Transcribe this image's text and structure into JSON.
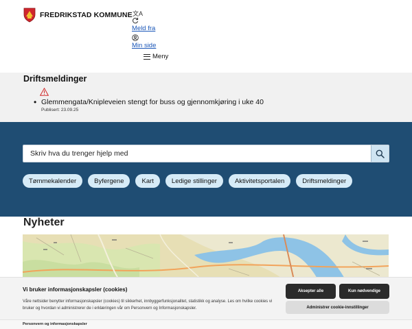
{
  "header": {
    "brand": "FREDRIKSTAD KOMMUNE",
    "links": [
      {
        "label": "Meld fra",
        "icon": "refresh-icon"
      },
      {
        "label": "Min side",
        "icon": "user-icon"
      }
    ],
    "menu_label": "Meny"
  },
  "alerts": {
    "title": "Driftsmeldinger",
    "items": [
      {
        "text": "Glemmengata/Knipleveien stengt for buss og gjennomkjøring i uke 40",
        "published": "Publisert: 23.09.25"
      }
    ]
  },
  "search": {
    "placeholder": "Skriv hva du trenger hjelp med"
  },
  "quick_links": [
    "Tømmekalender",
    "Byfergene",
    "Kart",
    "Ledige stillinger",
    "Aktivitetsportalen",
    "Driftsmeldinger"
  ],
  "news": {
    "title": "Nyheter"
  },
  "cookie": {
    "title": "Vi bruker informasjonskapsler (cookies)",
    "text": "Våre nettsider benytter informasjonskapsler (cookies) til sikkerhet, innbyggerfunksjonalitet, statistikk og analyse. Les om hvilke cookies vi bruker og hvordan vi administrerer de i erklæringen vår om Personvern og Informasjonskapsler.",
    "accept_label": "Aksepter alle",
    "necessary_label": "Kun nødvendige",
    "settings_label": "Administrer cookie-innstillinger",
    "footer_link": "Personvern og informasjonskapsler"
  },
  "colors": {
    "band": "#1f4d73",
    "chip": "#d6ebf7",
    "link": "#1a56b8",
    "dark_button": "#2b2b2b"
  }
}
